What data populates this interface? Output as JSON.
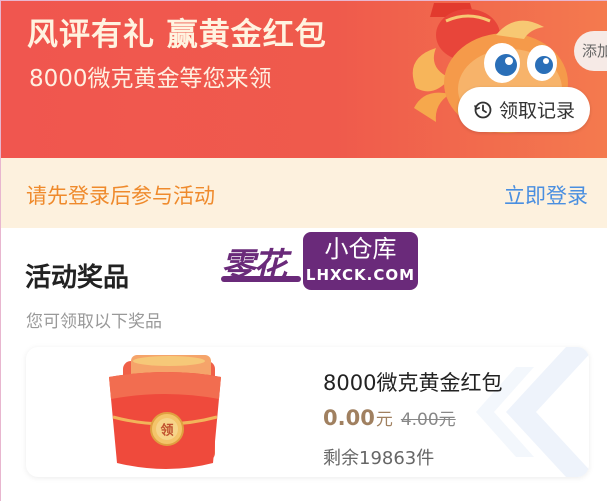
{
  "banner": {
    "title": "风评有礼 赢黄金红包",
    "subtitle": "8000微克黄金等您来领",
    "add_label": "添加",
    "record_label": "领取记录"
  },
  "login": {
    "tip": "请先登录后参与活动",
    "link": "立即登录"
  },
  "prizes_section": {
    "title": "活动奖品",
    "subtitle": "您可领取以下奖品"
  },
  "watermark": {
    "left": "零花",
    "box_top": "小仓库",
    "box_bottom": "LHXCK.COM"
  },
  "prize": {
    "name": "8000微克黄金红包",
    "price": "0.00",
    "unit": "元",
    "original_price": "4.00元",
    "stock": "剩余19863件",
    "envelope_glyph": "领"
  },
  "colors": {
    "banner_red": "#f0564f",
    "login_bg": "#fdf1de",
    "login_tip": "#ef8a2c",
    "login_link": "#4a8fe0",
    "price": "#a08060",
    "watermark": "#6a2a7a"
  }
}
